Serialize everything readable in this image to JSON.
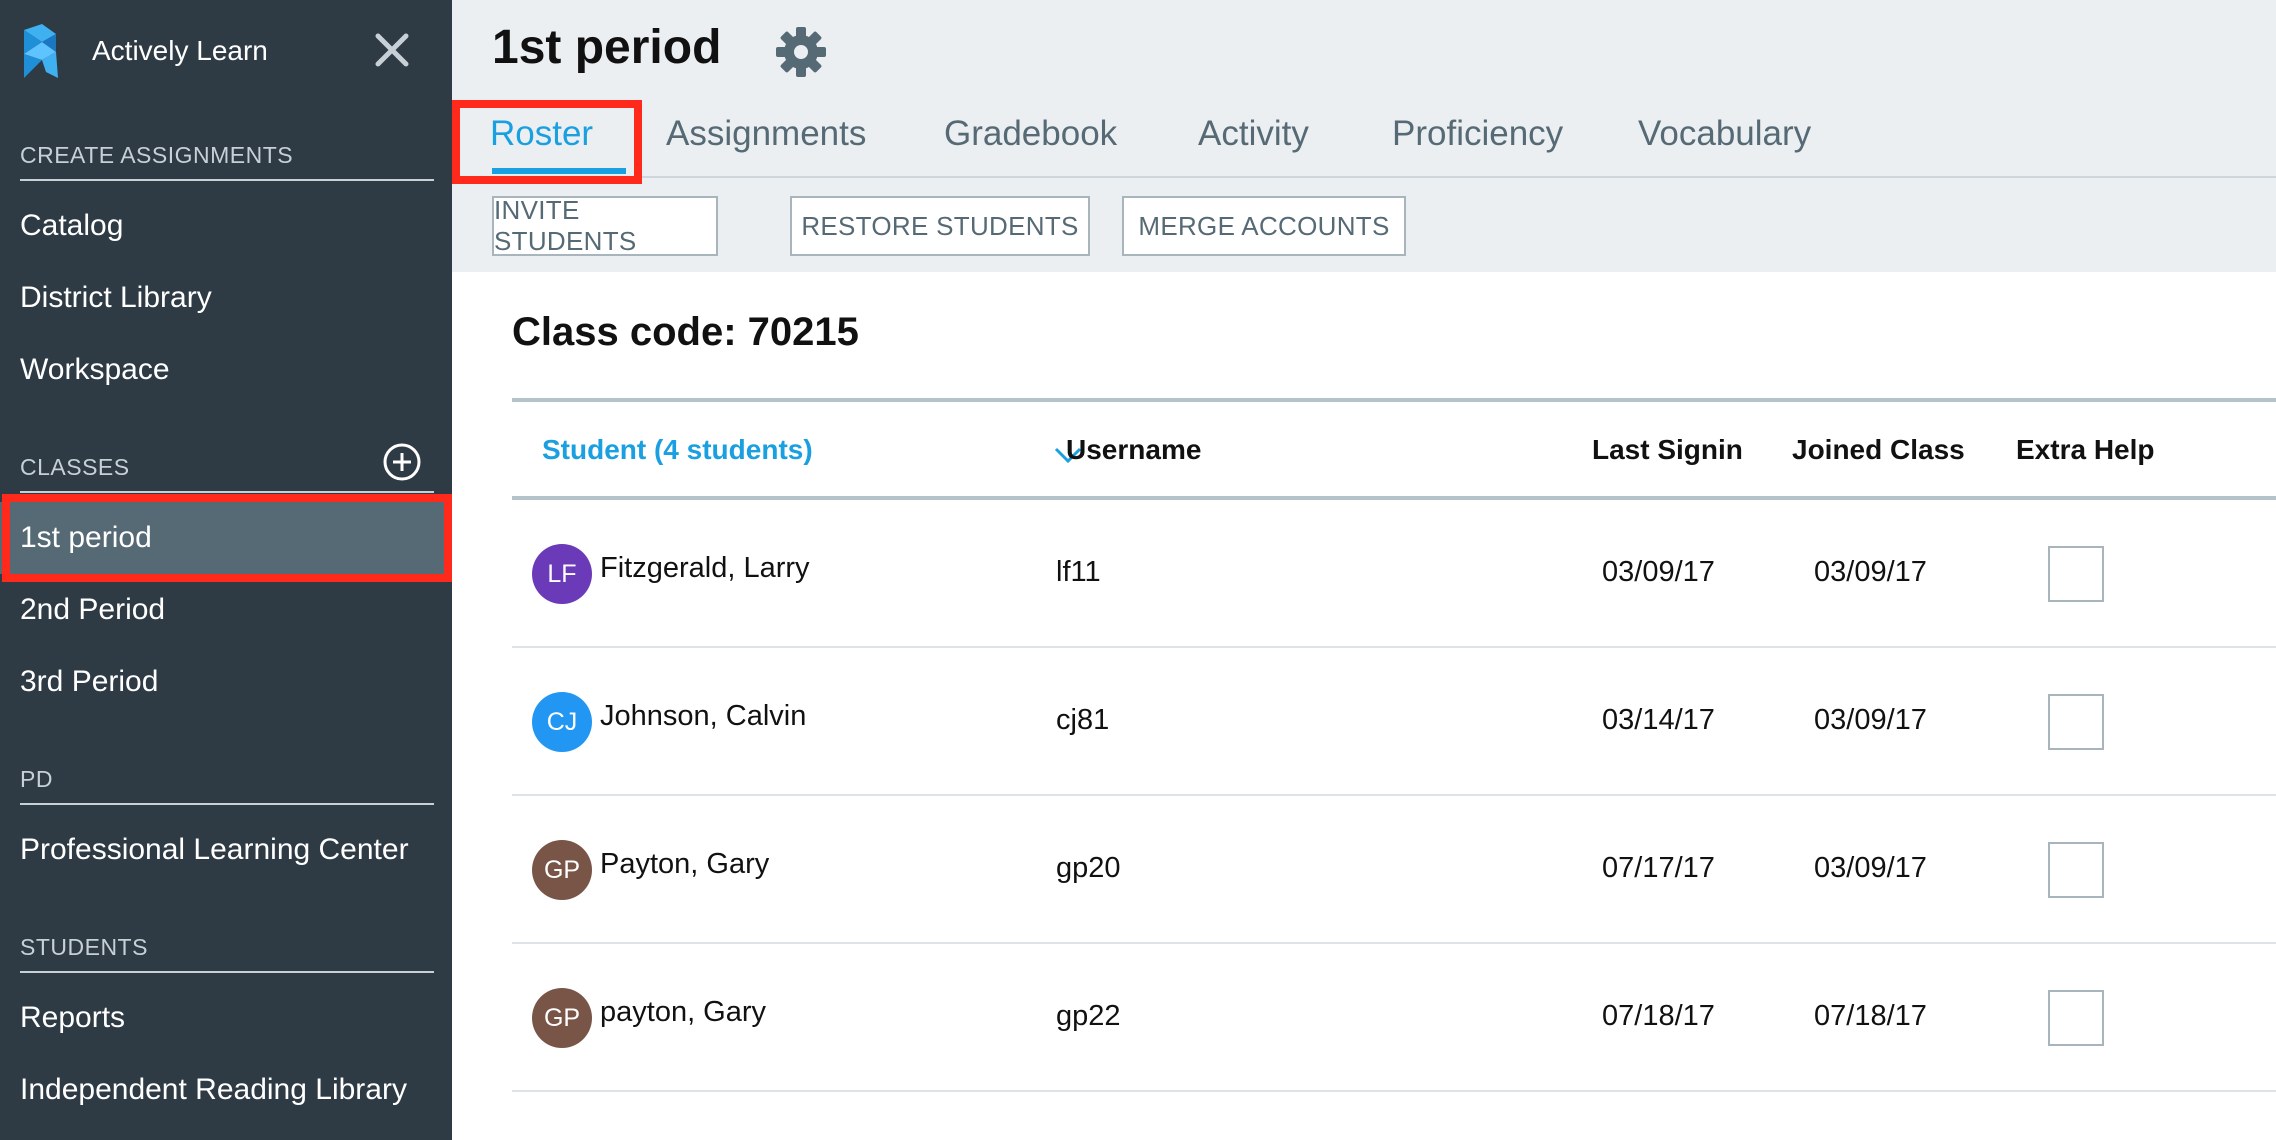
{
  "app": {
    "name": "Actively Learn"
  },
  "sidebar": {
    "sections": [
      {
        "heading": "CREATE ASSIGNMENTS",
        "items": [
          "Catalog",
          "District Library",
          "Workspace"
        ]
      },
      {
        "heading": "CLASSES",
        "items": [
          "1st period",
          "2nd Period",
          "3rd Period"
        ]
      },
      {
        "heading": "PD",
        "items": [
          "Professional Learning Center"
        ]
      },
      {
        "heading": "STUDENTS",
        "items": [
          "Reports",
          "Independent Reading Library"
        ]
      }
    ],
    "active_item": "1st period",
    "icons": {
      "close": "close-icon",
      "add_class": "plus-circle-icon",
      "logo": "actively-learn-logo"
    }
  },
  "header": {
    "title": "1st period",
    "settings_icon": "gear-icon",
    "tabs": [
      "Roster",
      "Assignments",
      "Gradebook",
      "Activity",
      "Proficiency",
      "Vocabulary"
    ],
    "active_tab": "Roster",
    "buttons": [
      "INVITE STUDENTS",
      "RESTORE STUDENTS",
      "MERGE ACCOUNTS"
    ]
  },
  "roster": {
    "class_code": "Class code: 70215",
    "columns": {
      "student": "Student (4 students)",
      "username": "Username",
      "last_signin": "Last Signin",
      "joined": "Joined Class",
      "extra_help": "Extra Help"
    },
    "rows": [
      {
        "initials": "LF",
        "name": "Fitzgerald, Larry",
        "username": "lf11",
        "last_signin": "03/09/17",
        "joined": "03/09/17",
        "extra_help": false,
        "avatar_color": "#6b3ab8"
      },
      {
        "initials": "CJ",
        "name": "Johnson, Calvin",
        "username": "cj81",
        "last_signin": "03/14/17",
        "joined": "03/09/17",
        "extra_help": false,
        "avatar_color": "#2196f3"
      },
      {
        "initials": "GP",
        "name": "Payton, Gary",
        "username": "gp20",
        "last_signin": "07/17/17",
        "joined": "03/09/17",
        "extra_help": false,
        "avatar_color": "#795548"
      },
      {
        "initials": "GP",
        "name": "payton, Gary",
        "username": "gp22",
        "last_signin": "07/18/17",
        "joined": "07/18/17",
        "extra_help": false,
        "avatar_color": "#795548"
      }
    ]
  },
  "colors": {
    "sidebar_bg": "#2e3b44",
    "active_item_bg": "#566a75",
    "accent": "#1a9fe0",
    "highlight": "#ff2a1c"
  }
}
